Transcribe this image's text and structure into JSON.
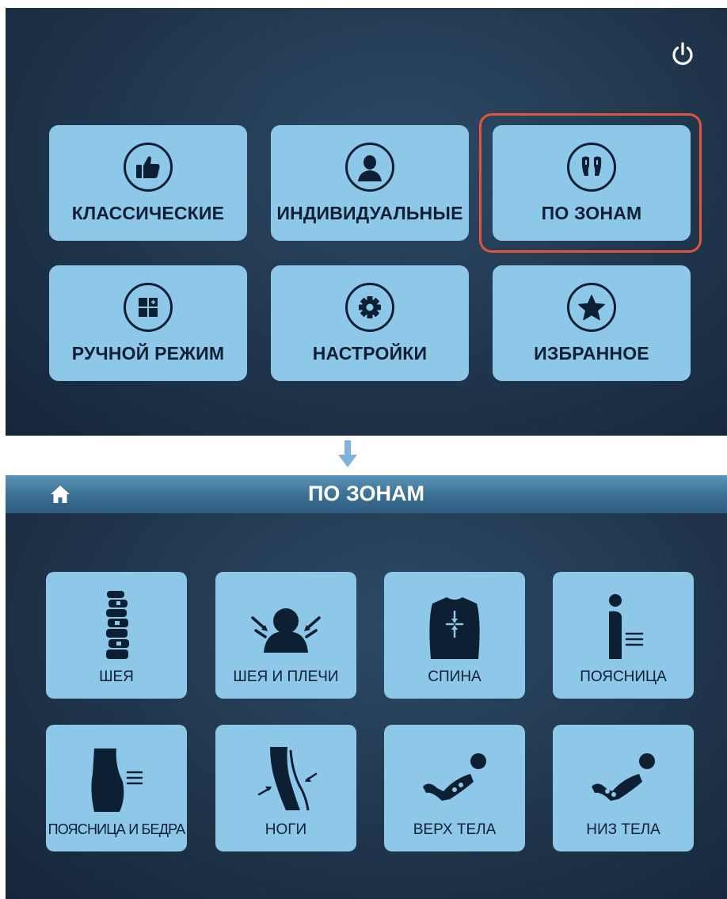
{
  "main_menu": {
    "buttons": [
      {
        "label": "КЛАССИЧЕСКИЕ",
        "icon": "thumbs-up-icon"
      },
      {
        "label": "ИНДИВИДУАЛЬНЫЕ",
        "icon": "person-icon"
      },
      {
        "label": "ПО ЗОНАМ",
        "icon": "zones-icon"
      },
      {
        "label": "РУЧНОЙ РЕЖИМ",
        "icon": "manual-mode-icon"
      },
      {
        "label": "НАСТРОЙКИ",
        "icon": "gear-icon"
      },
      {
        "label": "ИЗБРАННОЕ",
        "icon": "star-icon"
      }
    ],
    "highlighted": "ПО ЗОНАМ"
  },
  "zones_screen": {
    "title": "ПО ЗОНАМ",
    "items": [
      {
        "label": "ШЕЯ",
        "icon": "spine-icon"
      },
      {
        "label": "ШЕЯ И ПЛЕЧИ",
        "icon": "neck-shoulders-icon"
      },
      {
        "label": "СПИНА",
        "icon": "back-icon"
      },
      {
        "label": "ПОЯСНИЦА",
        "icon": "lower-back-icon"
      },
      {
        "label": "ПОЯСНИЦА И БЕДРА",
        "icon": "waist-hips-icon"
      },
      {
        "label": "НОГИ",
        "icon": "legs-icon"
      },
      {
        "label": "ВЕРХ ТЕЛА",
        "icon": "upper-body-icon"
      },
      {
        "label": "НИЗ ТЕЛА",
        "icon": "lower-body-icon"
      }
    ]
  },
  "colors": {
    "button_bg": "#8dc8e8",
    "icon_dark": "#0d1f33",
    "highlight": "#e0553b",
    "arrow": "#7fb3dc"
  }
}
